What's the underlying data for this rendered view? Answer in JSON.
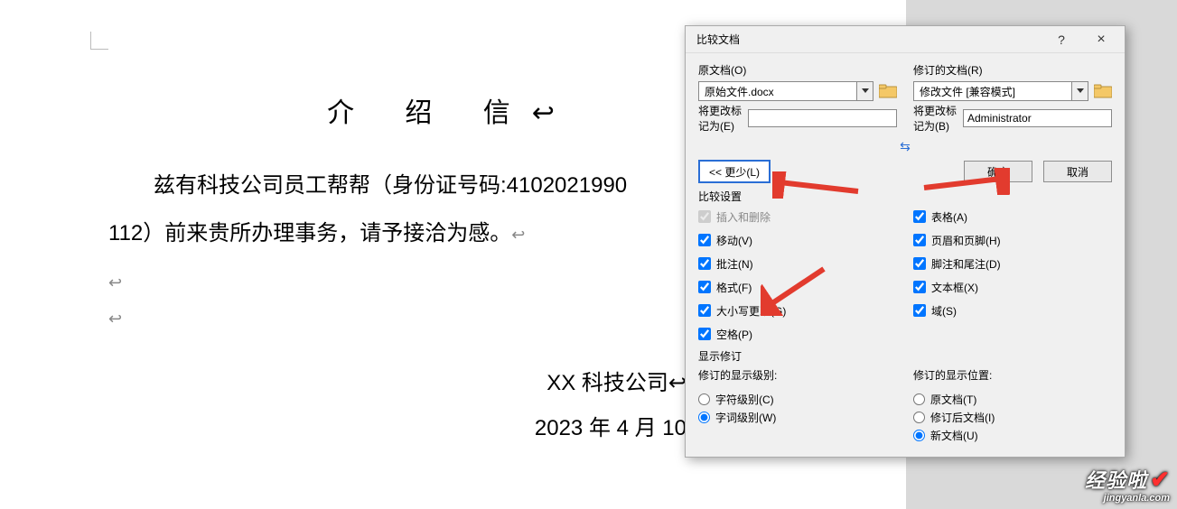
{
  "document": {
    "title": "介 绍 信",
    "line1": "兹有科技公司员工帮帮（身份证号码:4102021990",
    "line2": "112）前来贵所办理事务，请予接洽为感。",
    "sign_company": "XX 科技公司",
    "sign_date": "2023 年 4 月 10",
    "return_mark": "↩"
  },
  "dialog": {
    "title": "比较文档",
    "help": "?",
    "close": "×",
    "original": {
      "label": "原文档(O)",
      "file": "原始文件.docx",
      "mark_label": "将更改标记为(E)",
      "mark_value": ""
    },
    "revised": {
      "label": "修订的文档(R)",
      "file": "修改文件 [兼容模式]",
      "mark_label": "将更改标记为(B)",
      "mark_value": "Administrator"
    },
    "buttons": {
      "less": "<< 更少(L)",
      "ok": "确定",
      "cancel": "取消"
    },
    "swap": "⇆",
    "compare_settings_label": "比较设置",
    "settings_left": [
      {
        "label": "插入和删除",
        "checked": true,
        "disabled": true
      },
      {
        "label": "移动(V)",
        "checked": true
      },
      {
        "label": "批注(N)",
        "checked": true
      },
      {
        "label": "格式(F)",
        "checked": true
      },
      {
        "label": "大小写更改(G)",
        "checked": true
      },
      {
        "label": "空格(P)",
        "checked": true
      }
    ],
    "settings_right": [
      {
        "label": "表格(A)",
        "checked": true
      },
      {
        "label": "页眉和页脚(H)",
        "checked": true
      },
      {
        "label": "脚注和尾注(D)",
        "checked": true
      },
      {
        "label": "文本框(X)",
        "checked": true
      },
      {
        "label": "域(S)",
        "checked": true
      }
    ],
    "show_rev_label": "显示修订",
    "level": {
      "label": "修订的显示级别:",
      "opts": [
        {
          "label": "字符级别(C)",
          "checked": false
        },
        {
          "label": "字词级别(W)",
          "checked": true
        }
      ]
    },
    "location": {
      "label": "修订的显示位置:",
      "opts": [
        {
          "label": "原文档(T)",
          "checked": false
        },
        {
          "label": "修订后文档(I)",
          "checked": false
        },
        {
          "label": "新文档(U)",
          "checked": true
        }
      ]
    }
  },
  "watermark": {
    "big": "经验啦",
    "check": "✔",
    "small": "jingyanla.com"
  }
}
